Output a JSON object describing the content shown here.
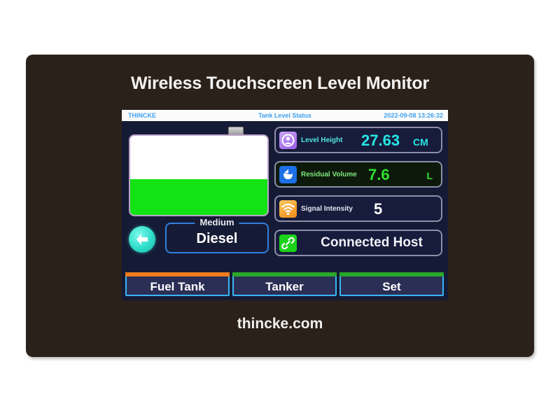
{
  "product": {
    "title": "Wireless Touchscreen Level Monitor",
    "brand": "thincke.com",
    "frame_color": "#2b211b"
  },
  "status_bar": {
    "logo": "THINCKE",
    "title": "Tank Level Status",
    "datetime": "2022-09-08 13:26:32",
    "text_color": "#3fa2f0",
    "background": "#fbfbfb"
  },
  "tank": {
    "fill_percent": 45,
    "fill_color": "#13e313",
    "empty_color": "#ffffff",
    "neck_icon": "tank-neck-cap"
  },
  "medium": {
    "label": "Medium",
    "value": "Diesel"
  },
  "back_button": {
    "icon": "left-arrow-icon",
    "color": "#2fdcc8"
  },
  "readouts": [
    {
      "icon": "level-gauge-icon",
      "icon_color": "#9b5ae8",
      "label": "Level Height",
      "value": "27.63",
      "unit": "CM",
      "value_color": "#27e6e6"
    },
    {
      "icon": "liquid-volume-icon",
      "icon_color": "#1d6fe5",
      "label": "Residual Volume",
      "value": "7.6",
      "unit": "L",
      "value_color": "#2fe22f"
    },
    {
      "icon": "wifi-signal-icon",
      "icon_color": "#f08a17",
      "label": "Signal Intensity",
      "value": "5",
      "unit": "",
      "value_color": "#ffffff"
    }
  ],
  "host": {
    "icon": "link-chain-icon",
    "icon_color": "#1ad21a",
    "label": "Connected Host"
  },
  "tabs": [
    {
      "label": "Fuel Tank",
      "accent": "#f07c1e",
      "active": true
    },
    {
      "label": "Tanker",
      "accent": "#2aa82a",
      "active": false
    },
    {
      "label": "Set",
      "accent": "#2aa82a",
      "active": false
    }
  ]
}
